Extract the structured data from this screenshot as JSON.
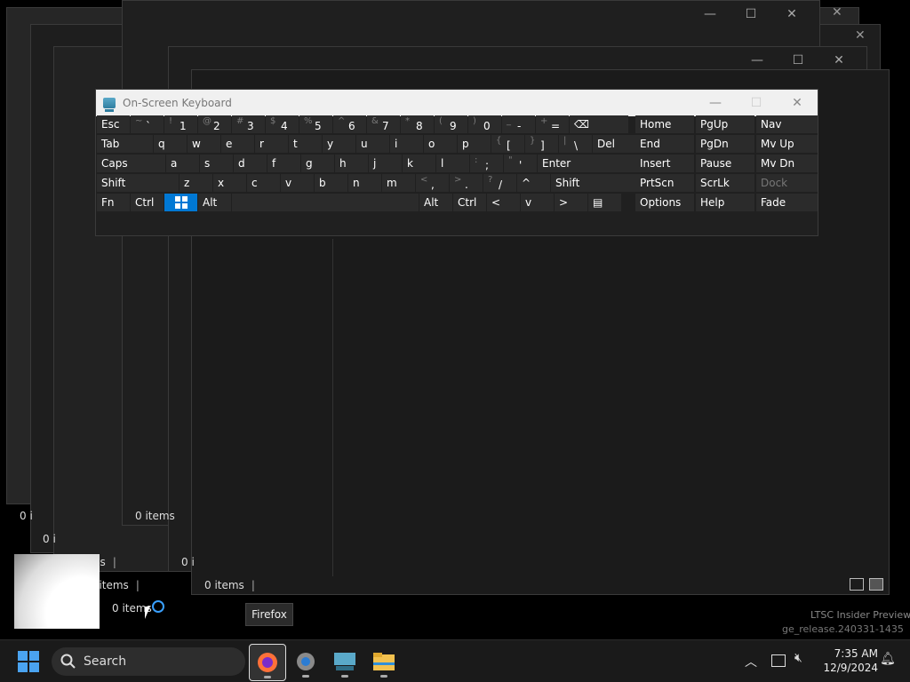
{
  "background_windows": {
    "status_items": [
      "0 i",
      "0 i",
      "0 items",
      "0 items",
      "0 i",
      "8 items",
      "0 items",
      "0 items"
    ],
    "watermark": [
      "LTSC Insider Preview",
      "ge_release.240331-1435"
    ]
  },
  "osk": {
    "title": "On-Screen Keyboard",
    "rows": [
      [
        {
          "label": "Esc"
        },
        {
          "shift": "~",
          "main": "`"
        },
        {
          "shift": "!",
          "main": "1"
        },
        {
          "shift": "@",
          "main": "2"
        },
        {
          "shift": "#",
          "main": "3"
        },
        {
          "shift": "$",
          "main": "4"
        },
        {
          "shift": "%",
          "main": "5"
        },
        {
          "shift": "^",
          "main": "6"
        },
        {
          "shift": "&",
          "main": "7"
        },
        {
          "shift": "*",
          "main": "8"
        },
        {
          "shift": "(",
          "main": "9"
        },
        {
          "shift": ")",
          "main": "0"
        },
        {
          "shift": "_",
          "main": "-"
        },
        {
          "shift": "+",
          "main": "="
        },
        {
          "label": "⌫"
        }
      ],
      [
        {
          "label": "Tab"
        },
        {
          "label": "q"
        },
        {
          "label": "w"
        },
        {
          "label": "e"
        },
        {
          "label": "r"
        },
        {
          "label": "t"
        },
        {
          "label": "y"
        },
        {
          "label": "u"
        },
        {
          "label": "i"
        },
        {
          "label": "o"
        },
        {
          "label": "p"
        },
        {
          "shift": "{",
          "main": "["
        },
        {
          "shift": "}",
          "main": "]"
        },
        {
          "shift": "|",
          "main": "\\"
        },
        {
          "label": "Del"
        }
      ],
      [
        {
          "label": "Caps"
        },
        {
          "label": "a"
        },
        {
          "label": "s"
        },
        {
          "label": "d"
        },
        {
          "label": "f"
        },
        {
          "label": "g"
        },
        {
          "label": "h"
        },
        {
          "label": "j"
        },
        {
          "label": "k"
        },
        {
          "label": "l"
        },
        {
          "shift": ":",
          "main": ";"
        },
        {
          "shift": "\"",
          "main": "'"
        },
        {
          "label": "Enter"
        }
      ],
      [
        {
          "label": "Shift"
        },
        {
          "label": "z"
        },
        {
          "label": "x"
        },
        {
          "label": "c"
        },
        {
          "label": "v"
        },
        {
          "label": "b"
        },
        {
          "label": "n"
        },
        {
          "label": "m"
        },
        {
          "shift": "<",
          "main": ","
        },
        {
          "shift": ">",
          "main": "."
        },
        {
          "shift": "?",
          "main": "/"
        },
        {
          "label": "^"
        },
        {
          "label": "Shift"
        }
      ],
      [
        {
          "label": "Fn"
        },
        {
          "label": "Ctrl"
        },
        {
          "label": ""
        },
        {
          "label": "Alt"
        },
        {
          "label": ""
        },
        {
          "label": "Alt"
        },
        {
          "label": "Ctrl"
        },
        {
          "label": "<"
        },
        {
          "label": "v"
        },
        {
          "label": ">"
        },
        {
          "label": "▤"
        }
      ]
    ],
    "nav": [
      [
        "Home",
        "PgUp",
        "Nav"
      ],
      [
        "End",
        "PgDn",
        "Mv Up"
      ],
      [
        "Insert",
        "Pause",
        "Mv Dn"
      ],
      [
        "PrtScn",
        "ScrLk",
        "Dock"
      ],
      [
        "Options",
        "Help",
        "Fade"
      ]
    ]
  },
  "taskbar": {
    "search_label": "Search",
    "tooltip": "Firefox",
    "time": "7:35 AM",
    "date": "12/9/2024",
    "accent": "#0078d4"
  }
}
